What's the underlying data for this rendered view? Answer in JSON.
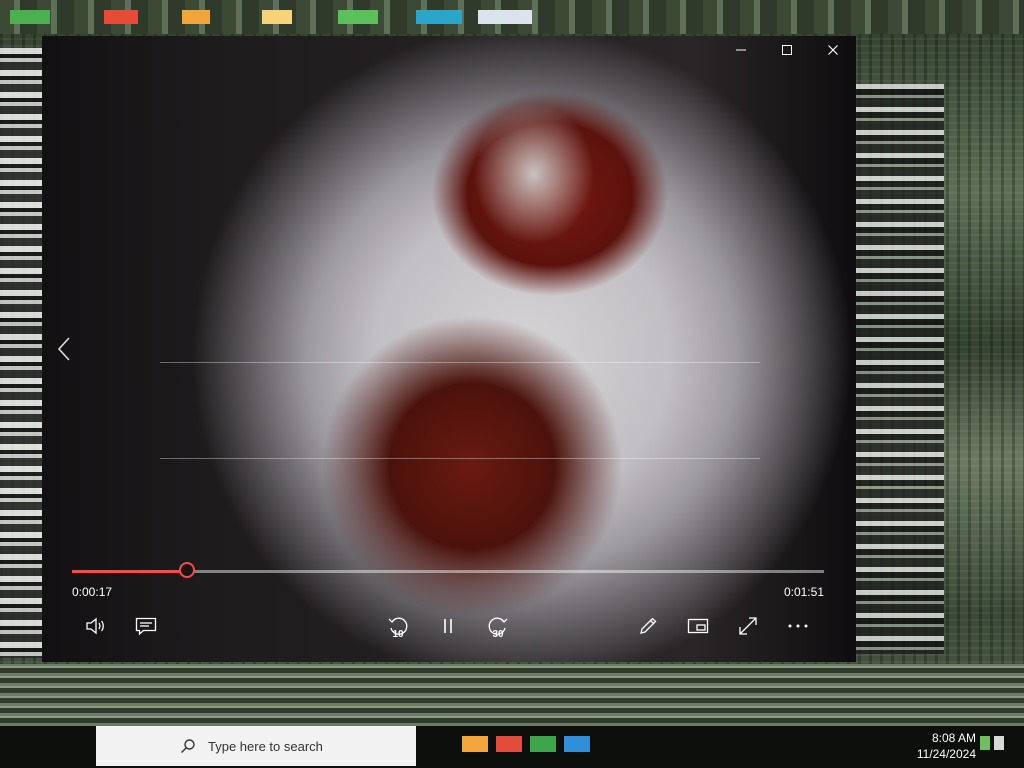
{
  "window": {
    "minimize_label": "–",
    "maximize_label": "□",
    "close_label": "×"
  },
  "player": {
    "elapsed": "0:00:17",
    "duration": "0:01:51",
    "progress": 0.153,
    "skip_back_label": "10",
    "skip_forward_label": "30",
    "accent_color": "#ee4f4f",
    "controls": [
      "volume-icon",
      "subtitles-icon",
      "skip-back-10-icon",
      "pause-icon",
      "skip-forward-30-icon",
      "edit-pen-icon",
      "mini-view-icon",
      "fullscreen-icon",
      "more-options-icon"
    ]
  },
  "taskbar": {
    "search_placeholder": "Type here to search",
    "time": "8:08 AM",
    "date": "11/24/2024"
  }
}
